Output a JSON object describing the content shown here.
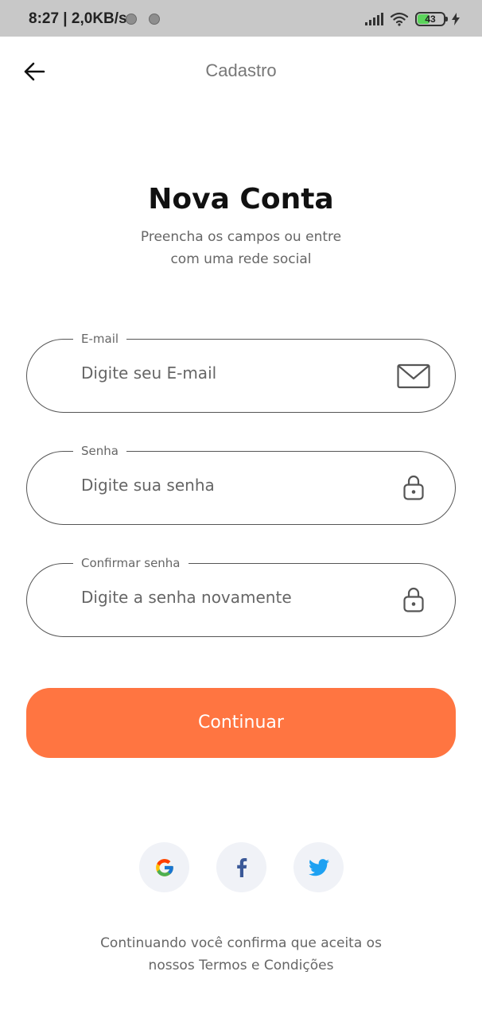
{
  "status_bar": {
    "time_speed": "8:27 | 2,0KB/s",
    "battery": "43"
  },
  "app_bar": {
    "title": "Cadastro",
    "back_icon": "arrow-left-icon"
  },
  "header": {
    "title": "Nova Conta",
    "subtitle_line1": "Preencha os campos ou entre",
    "subtitle_line2": "com uma rede social"
  },
  "form": {
    "email": {
      "label": "E-mail",
      "placeholder": "Digite seu E-mail",
      "value": "",
      "icon": "envelope-icon"
    },
    "password": {
      "label": "Senha",
      "placeholder": "Digite sua senha",
      "value": "",
      "icon": "lock-icon"
    },
    "confirm_password": {
      "label": "Confirmar senha",
      "placeholder": "Digite a senha novamente",
      "value": "",
      "icon": "lock-icon"
    },
    "submit_label": "Continuar"
  },
  "social": {
    "google_icon": "google-icon",
    "facebook_icon": "facebook-icon",
    "twitter_icon": "twitter-icon"
  },
  "footer": {
    "terms_line1": "Continuando você confirma que aceita os",
    "terms_line2": "nossos Termos e Condições"
  },
  "colors": {
    "accent": "#ff7541",
    "statusbar": "#c8c8c8",
    "social_bg": "#f0f2f7",
    "facebook": "#3b5998",
    "twitter": "#1da1f2"
  }
}
